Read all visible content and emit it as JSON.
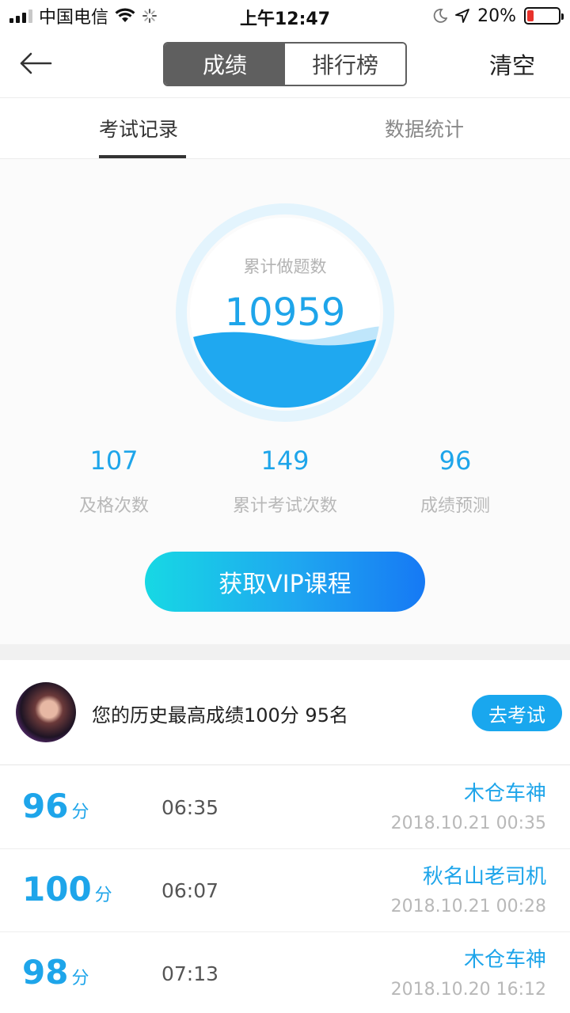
{
  "status_bar": {
    "carrier": "中国电信",
    "time": "上午12:47",
    "battery_percent": "20%",
    "battery_level": 0.2,
    "signal_icon": "signal-bars-icon",
    "wifi_icon": "wifi-icon",
    "loading_icon": "loading-spinner-icon",
    "moon_icon": "moon-icon",
    "location_icon": "location-arrow-icon"
  },
  "nav": {
    "back_icon": "back-arrow-icon",
    "segments": [
      "成绩",
      "排行榜"
    ],
    "selected_segment": "成绩",
    "clear_label": "清空"
  },
  "tabs": {
    "items": [
      "考试记录",
      "数据统计"
    ],
    "active": "考试记录"
  },
  "gauge": {
    "label": "累计做题数",
    "value": "10959"
  },
  "metrics": [
    {
      "value": "107",
      "label": "及格次数"
    },
    {
      "value": "149",
      "label": "累计考试次数"
    },
    {
      "value": "96",
      "label": "成绩预测"
    }
  ],
  "vip_button": "获取VIP课程",
  "best": {
    "text": "您的历史最高成绩100分  95名",
    "go_exam_label": "去考试"
  },
  "records": [
    {
      "score": "96",
      "unit": "分",
      "duration": "06:35",
      "name": "木仓车神",
      "time": "2018.10.21 00:35"
    },
    {
      "score": "100",
      "unit": "分",
      "duration": "06:07",
      "name": "秋名山老司机",
      "time": "2018.10.21 00:28"
    },
    {
      "score": "98",
      "unit": "分",
      "duration": "07:13",
      "name": "木仓车神",
      "time": "2018.10.20 16:12"
    }
  ],
  "colors": {
    "accent": "#1ea5ea",
    "segment_active": "#5f5f5f",
    "vip_gradient_start": "#17d8e4",
    "vip_gradient_end": "#1679f4",
    "battery_low": "#e8322b"
  }
}
